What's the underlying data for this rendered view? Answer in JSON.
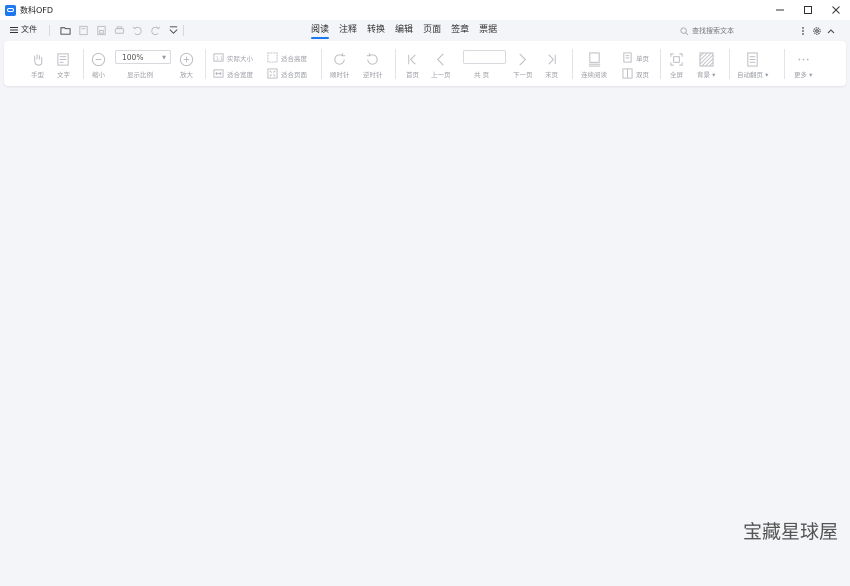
{
  "window": {
    "title": "数科OFD",
    "logo_color": "#1e78f0"
  },
  "menu": {
    "file_label": "文件"
  },
  "tabs": [
    {
      "label": "阅读",
      "active": true
    },
    {
      "label": "注释"
    },
    {
      "label": "转换"
    },
    {
      "label": "编辑"
    },
    {
      "label": "页面"
    },
    {
      "label": "签章"
    },
    {
      "label": "票据"
    }
  ],
  "search": {
    "placeholder": "查找搜索文本"
  },
  "ribbon": {
    "hand": "手型",
    "select_text": "文字",
    "zoom_out": "缩小",
    "zoom_value": "100%",
    "zoom_label": "显示比例",
    "zoom_in": "放大",
    "actual_size": "实际大小",
    "fit_width": "适合宽度",
    "fit_height": "适合高度",
    "fit_page": "适合页面",
    "rotate_cw": "顺时针",
    "rotate_ccw": "逆时针",
    "first_page": "首页",
    "prev_page": "上一页",
    "page_label": "共 页",
    "next_page": "下一页",
    "last_page": "末页",
    "continuous": "连续阅读",
    "single_page": "单页",
    "double_page": "双页",
    "fullscreen": "全屏",
    "background": "背景",
    "auto_scroll": "自动翻页",
    "more": "更多"
  },
  "watermark": "宝藏星球屋",
  "colors": {
    "accent": "#1e78f0",
    "icon_disabled": "#b8bac0",
    "background": "#f4f5f8"
  }
}
